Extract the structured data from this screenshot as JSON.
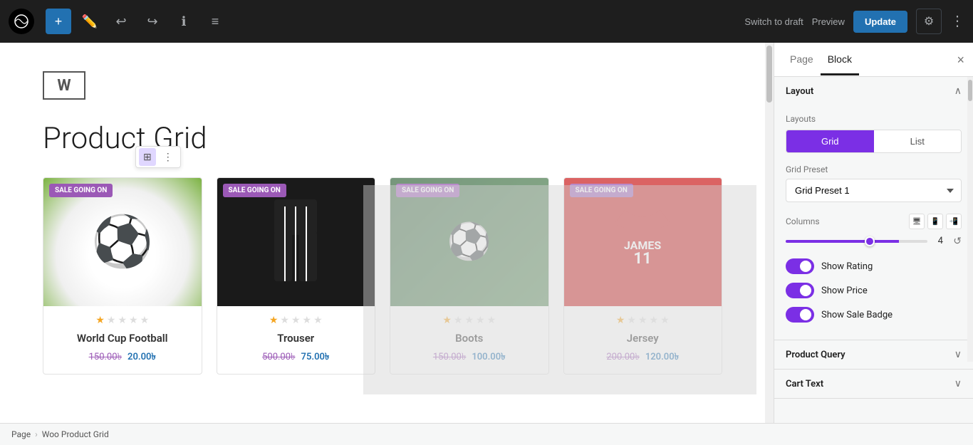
{
  "topbar": {
    "add_label": "+",
    "undo_label": "↩",
    "redo_label": "↪",
    "info_label": "ℹ",
    "list_label": "≡",
    "switch_draft_label": "Switch to draft",
    "preview_label": "Preview",
    "update_label": "Update"
  },
  "panel": {
    "page_tab": "Page",
    "block_tab": "Block",
    "close_label": "×"
  },
  "layout_section": {
    "title": "Layout",
    "layouts_label": "Layouts",
    "grid_label": "Grid",
    "list_label": "List",
    "grid_preset_label": "Grid Preset",
    "grid_preset_value": "Grid Preset 1",
    "columns_label": "Columns",
    "columns_value": "4",
    "slider_value": 80
  },
  "toggles": {
    "show_rating_label": "Show Rating",
    "show_price_label": "Show Price",
    "show_sale_badge_label": "Show Sale Badge"
  },
  "product_query_section": {
    "title": "Product Query"
  },
  "cart_text_section": {
    "title": "Cart Text"
  },
  "page_title": "Product Grid",
  "products": [
    {
      "name": "World Cup Football",
      "sale_badge": "SALE GOING ON",
      "old_price": "150.00৳",
      "new_price": "20.00৳",
      "stars": [
        true,
        false,
        false,
        false,
        false
      ],
      "type": "football"
    },
    {
      "name": "Trouser",
      "sale_badge": "SALE GOING ON",
      "old_price": "500.00৳",
      "new_price": "75.00৳",
      "stars": [
        true,
        false,
        false,
        false,
        false
      ],
      "type": "trouser"
    },
    {
      "name": "Boots",
      "sale_badge": "SALE GOING ON",
      "old_price": "150.00৳",
      "new_price": "100.00৳",
      "stars": [
        true,
        false,
        false,
        false,
        false
      ],
      "type": "boots"
    },
    {
      "name": "Jersey",
      "sale_badge": "SALE GOING ON",
      "old_price": "200.00৳",
      "new_price": "120.00৳",
      "stars": [
        true,
        false,
        false,
        false,
        false
      ],
      "type": "jersey"
    }
  ],
  "breadcrumb": {
    "page_label": "Page",
    "separator": "›",
    "current_label": "Woo Product Grid"
  }
}
